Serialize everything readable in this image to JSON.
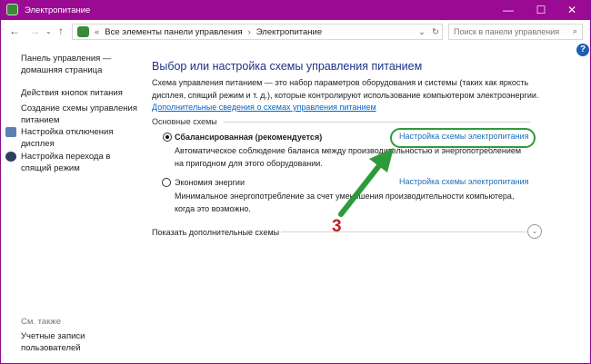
{
  "window": {
    "title": "Электропитание",
    "minimize": "—",
    "maximize": "☐",
    "close": "✕"
  },
  "address": {
    "prefix": "«",
    "crumbs": [
      "Все элементы панели управления",
      "Электропитание"
    ],
    "separator": "›",
    "dropdown": "⌄",
    "refresh": "↻"
  },
  "search": {
    "placeholder": "Поиск в панели управления",
    "icon": "⌕"
  },
  "help": "?",
  "sidebar": {
    "items": [
      {
        "label": "Панель управления —\nдомашняя страница"
      },
      {
        "label": "Действия кнопок питания"
      },
      {
        "label": "Создание схемы управления\nпитанием"
      },
      {
        "label": "Настройка отключения\nдисплея",
        "icon": "display-icon"
      },
      {
        "label": "Настройка перехода в\nспящий режим",
        "icon": "moon-icon"
      }
    ],
    "see_also": "См. также",
    "see_also_items": [
      {
        "label": "Учетные записи\nпользователей"
      }
    ]
  },
  "main": {
    "title": "Выбор или настройка схемы управления питанием",
    "desc1": "Схема управления питанием — это набор параметров оборудования и системы (таких как яркость",
    "desc2": "дисплея, спящий режим и т. д.), которые контролируют использование компьютером электроэнергии.",
    "more_link": "Дополнительные сведения о схемах управления питанием",
    "section": "Основные схемы",
    "plans": [
      {
        "name": "Сбалансированная (рекомендуется)",
        "selected": true,
        "link": "Настройка схемы электропитания",
        "d1": "Автоматическое соблюдение баланса между производительностью и энергопотреблением",
        "d2": "на пригодном для этого оборудовании."
      },
      {
        "name": "Экономия энергии",
        "selected": false,
        "link": "Настройка схемы электропитания",
        "d1": "Минимальное энергопотребление за счет уменьшения производительности компьютера,",
        "d2": "когда это возможно."
      }
    ],
    "show_more": "Показать дополнительные схемы"
  },
  "annotation": {
    "step": "3",
    "color": "#2f9a3a"
  }
}
